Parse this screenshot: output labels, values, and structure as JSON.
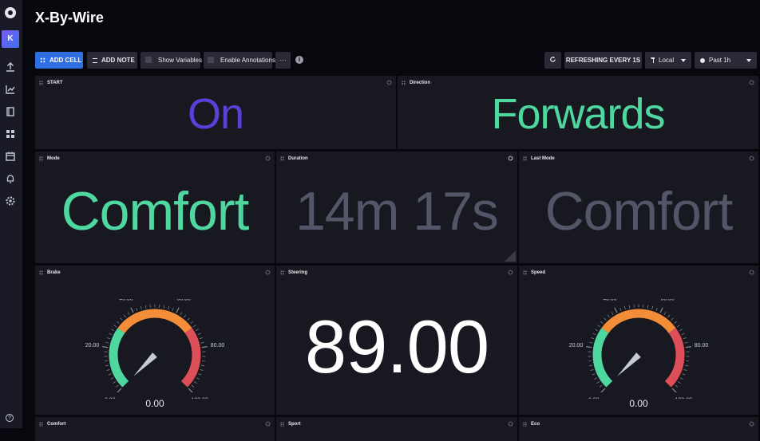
{
  "dashboard": {
    "title": "X-By-Wire"
  },
  "sidebar": {
    "org_initial": "K",
    "icons": [
      "upload-icon",
      "chart-icon",
      "book-icon",
      "dashboard-icon",
      "calendar-icon",
      "bell-icon",
      "gear-icon"
    ],
    "help_label": "?"
  },
  "toolbar": {
    "add_cell": "ADD CELL",
    "add_note": "ADD NOTE",
    "show_variables": "Show Variables",
    "enable_annotations": "Enable Annotations",
    "more": "···",
    "refresh_label": "REFRESHING EVERY 1S",
    "timezone": "Local",
    "time_range": "Past 1h"
  },
  "cells": {
    "start": {
      "title": "START",
      "value": "On",
      "color": "#5b3fd9"
    },
    "direction": {
      "title": "Direction",
      "value": "Forwards",
      "color": "#4ed8a0"
    },
    "mode": {
      "title": "Mode",
      "value": "Comfort",
      "color": "#4ed8a0"
    },
    "duration": {
      "title": "Duration",
      "value": "14m 17s",
      "color": "#545667"
    },
    "last_mode": {
      "title": "Last Mode",
      "value": "Comfort",
      "color": "#545667"
    },
    "brake": {
      "title": "Brake",
      "value_label": "0.00",
      "value": 0,
      "min": 0,
      "max": 100,
      "ticks": [
        "0.00",
        "20.00",
        "40.00",
        "60.00",
        "80.00",
        "100.00"
      ]
    },
    "steering": {
      "title": "Steering",
      "value": "89.00",
      "color": "#ffffff"
    },
    "speed": {
      "title": "Speed",
      "value_label": "0.00",
      "value": 0,
      "min": 0,
      "max": 100,
      "ticks": [
        "0.00",
        "20.00",
        "40.00",
        "60.00",
        "80.00",
        "100.00"
      ]
    },
    "comfort": {
      "title": "Comfort"
    },
    "sport": {
      "title": "Sport"
    },
    "eco": {
      "title": "Eco"
    }
  },
  "colors": {
    "gauge_green": "#4ed8a0",
    "gauge_orange": "#f48d38",
    "gauge_red": "#dc4e58",
    "accent": "#2f6fe3"
  }
}
